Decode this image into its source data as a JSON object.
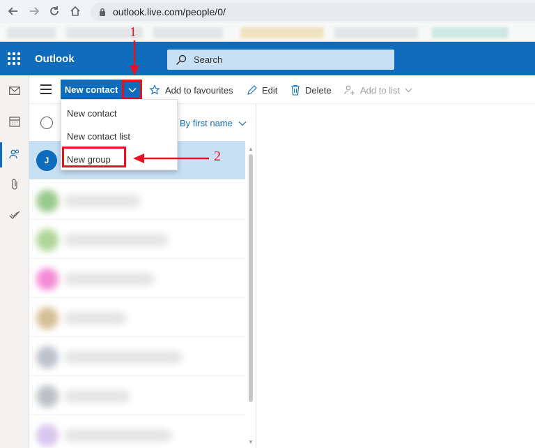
{
  "browser": {
    "url": "outlook.live.com/people/0/"
  },
  "header": {
    "app_name": "Outlook",
    "search_placeholder": "Search"
  },
  "toolbar": {
    "new_contact_label": "New contact",
    "add_to_favourites_label": "Add to favourites",
    "edit_label": "Edit",
    "delete_label": "Delete",
    "add_to_list_label": "Add to list"
  },
  "dropdown": {
    "items": [
      {
        "label": "New contact"
      },
      {
        "label": "New contact list"
      },
      {
        "label": "New group"
      }
    ]
  },
  "contact_list": {
    "sort_label": "By first name",
    "selected_contact_initial": "J",
    "blurred_avatar_colors": [
      "#8cc47e",
      "#a6d18a",
      "#f27fd0",
      "#cfb98a",
      "#b5bcc4",
      "#b5babf",
      "#d3c0ec"
    ]
  },
  "annotations": {
    "step1": "1",
    "step2": "2",
    "color": "#e81123"
  },
  "colors": {
    "brand_blue": "#0f6cbd",
    "selection": "#c7e0f4"
  }
}
